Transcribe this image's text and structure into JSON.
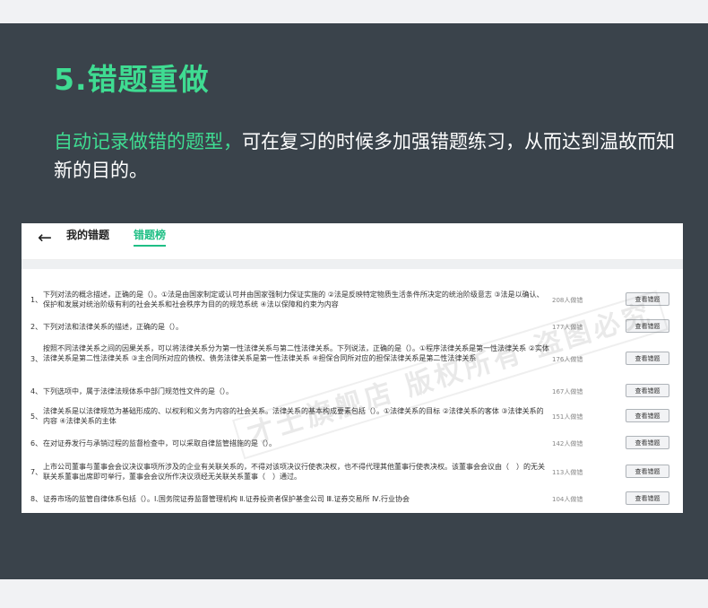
{
  "title": "5.错题重做",
  "subtitle": {
    "highlight": "自动记录做错的题型，",
    "rest": "可在复习的时候多加强错题练习，从而达到温故而知新的目的。"
  },
  "card": {
    "back_icon": "arrow-left-icon",
    "tabs": [
      "我的错题",
      "错题榜"
    ],
    "button_label": "查看错题",
    "rows": [
      {
        "num": "1、",
        "text": "下列对法的概念描述，正确的是（）。①法是由国家制定或认可并由国家强制力保证实施的 ②法是反映特定物质生活条件所决定的统治阶级意志 ③法是以确认、保护和发展对统治阶级有利的社会关系和社会秩序为目的的规范系统 ④法以保障和约束为内容",
        "count": "208人做错"
      },
      {
        "num": "2、",
        "text": "下列对法和法律关系的描述，正确的是（）。",
        "count": "177人做错"
      },
      {
        "num": "3、",
        "text": "按照不同法律关系之间的因果关系，可以将法律关系分为第一性法律关系与第二性法律关系。下列说法，正确的是（）。①程序法律关系是第一性法律关系 ②实体法律关系是第二性法律关系 ③主合同所对应的债权、债务法律关系是第一性法律关系 ④担保合同所对应的担保法律关系是第二性法律关系",
        "count": "176人做错"
      },
      {
        "num": "4、",
        "text": "下列选项中，属于法律法规体系中部门规范性文件的是（）。",
        "count": "167人做错"
      },
      {
        "num": "5、",
        "text": "法律关系是以法律规范为基础形成的、以权利和义务为内容的社会关系。法律关系的基本构成要素包括（）。①法律关系的目标 ②法律关系的客体 ③法律关系的内容 ④法律关系的主体",
        "count": "151人做错"
      },
      {
        "num": "6、",
        "text": "在对证券发行与承销过程的监督检查中，可以采取自律监管措施的是（）。",
        "count": "142人做错"
      },
      {
        "num": "7、",
        "text": "上市公司董事与董事会会议决议事项所涉及的企业有关联关系的，不得对该项决议行使表决权，也不得代理其他董事行使表决权。该董事会会议由（　）的无关联关系董事出席即可举行，董事会会议所作决议须经无关联关系董事（　）通过。",
        "count": "113人做错"
      },
      {
        "num": "8、",
        "text": "证券市场的监管自律体系包括（）。Ⅰ.国务院证券监督管理机构 Ⅱ.证券投资者保护基金公司 Ⅲ.证券交易所 Ⅳ.行业协会",
        "count": "104人做错"
      }
    ]
  },
  "watermark": "才士旗舰店 版权所有 盗图必究",
  "colors": {
    "accent": "#3fdc92",
    "panel": "#3a434b",
    "tab_active": "#1fbf85"
  }
}
